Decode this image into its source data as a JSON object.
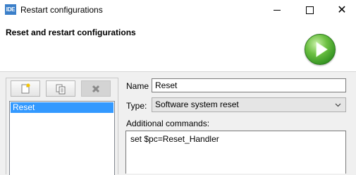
{
  "window": {
    "app_icon_text": "IDE",
    "title": "Restart configurations",
    "close_glyph": "✕"
  },
  "header": {
    "title": "Reset and restart configurations",
    "run_icon": "green-play-button"
  },
  "toolbar": {
    "new_icon": "new-config-icon",
    "copy_icon": "duplicate-icon",
    "delete_icon": "delete-icon",
    "delete_enabled": false
  },
  "list": {
    "items": [
      {
        "label": "Reset",
        "selected": true
      }
    ]
  },
  "form": {
    "name_label": "Name",
    "name_value": "Reset",
    "type_label": "Type:",
    "type_value": "Software system reset",
    "commands_label": "Additional commands:",
    "commands_value": "set $pc=Reset_Handler"
  },
  "colors": {
    "selection": "#3399ff",
    "run_icon_green": "#4caf2a"
  }
}
